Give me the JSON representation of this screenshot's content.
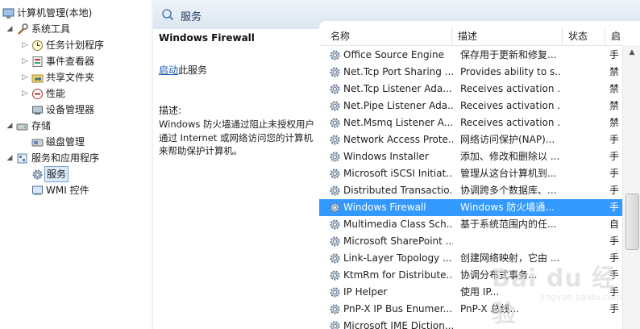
{
  "tree": {
    "items": [
      {
        "label": "计算机管理(本地)",
        "icon": "computer-management-icon",
        "level": 0,
        "arrow": ""
      },
      {
        "label": "系统工具",
        "icon": "tools-icon",
        "level": 1,
        "arrow": "◢"
      },
      {
        "label": "任务计划程序",
        "icon": "task-scheduler-icon",
        "level": 2,
        "arrow": "▷"
      },
      {
        "label": "事件查看器",
        "icon": "event-viewer-icon",
        "level": 2,
        "arrow": "▷"
      },
      {
        "label": "共享文件夹",
        "icon": "shared-folder-icon",
        "level": 2,
        "arrow": "▷"
      },
      {
        "label": "性能",
        "icon": "performance-icon",
        "level": 2,
        "arrow": "▷"
      },
      {
        "label": "设备管理器",
        "icon": "device-manager-icon",
        "level": 2,
        "arrow": ""
      },
      {
        "label": "存储",
        "icon": "storage-icon",
        "level": 1,
        "arrow": "◢"
      },
      {
        "label": "磁盘管理",
        "icon": "disk-management-icon",
        "level": 2,
        "arrow": ""
      },
      {
        "label": "服务和应用程序",
        "icon": "services-apps-icon",
        "level": 1,
        "arrow": "◢"
      },
      {
        "label": "服务",
        "icon": "services-gear-icon",
        "level": 2,
        "arrow": "",
        "selected": true
      },
      {
        "label": "WMI 控件",
        "icon": "wmi-icon",
        "level": 2,
        "arrow": ""
      }
    ]
  },
  "header": {
    "title": "服务"
  },
  "details": {
    "title": "Windows Firewall",
    "start_link": "启动",
    "start_suffix": "此服务",
    "desc_label": "描述:",
    "desc_text": "Windows 防火墙通过阻止未授权用户通过 Internet 或网络访问您的计算机来帮助保护计算机。"
  },
  "columns": {
    "name": "名称",
    "desc": "描述",
    "status": "状态",
    "startup": "启"
  },
  "services": [
    {
      "name": "Office  Source Engine",
      "desc": "保存用于更新和修复...",
      "startup": "手"
    },
    {
      "name": "Net.Tcp Port Sharing ...",
      "desc": "Provides ability to s...",
      "startup": "禁"
    },
    {
      "name": "Net.Tcp Listener Ada...",
      "desc": "Receives activation ...",
      "startup": "禁"
    },
    {
      "name": "Net.Pipe Listener Ada...",
      "desc": "Receives activation ...",
      "startup": "禁"
    },
    {
      "name": "Net.Msmq Listener A...",
      "desc": "Receives activation ...",
      "startup": "禁"
    },
    {
      "name": "Network Access Prote...",
      "desc": "网络访问保护(NAP)...",
      "startup": "手"
    },
    {
      "name": "Windows Installer",
      "desc": "添加、修改和删除以 ...",
      "startup": "手"
    },
    {
      "name": "Microsoft iSCSI Initiat...",
      "desc": "管理从这台计算机到...",
      "startup": "手"
    },
    {
      "name": "Distributed Transactio...",
      "desc": "协调跨多个数据库、...",
      "startup": "手"
    },
    {
      "name": "Windows Firewall",
      "desc": "Windows 防火墙通...",
      "startup": "手",
      "selected": true
    },
    {
      "name": "Multimedia Class Sch...",
      "desc": "基于系统范围内的任...",
      "startup": "自"
    },
    {
      "name": "Microsoft SharePoint ...",
      "desc": "",
      "startup": "手"
    },
    {
      "name": "Link-Layer Topology ...",
      "desc": "创建网络映射，它由 ...",
      "startup": "手"
    },
    {
      "name": "KtmRm for Distribute...",
      "desc": "协调分布式事务...",
      "startup": "手"
    },
    {
      "name": "IP Helper",
      "desc": "使用 IP...",
      "startup": "手"
    },
    {
      "name": "PnP-X IP Bus Enumer...",
      "desc": "PnP-X 总线...",
      "startup": "手"
    },
    {
      "name": "Microsoft IME Diction...",
      "desc": "",
      "startup": ""
    }
  ],
  "watermark": {
    "text": "Bai du 经验",
    "sub": "jingyan.baidu.com"
  },
  "colors": {
    "selection": "#3399ff",
    "link": "#1c59b3",
    "header_bg": "#dbe6f2"
  }
}
